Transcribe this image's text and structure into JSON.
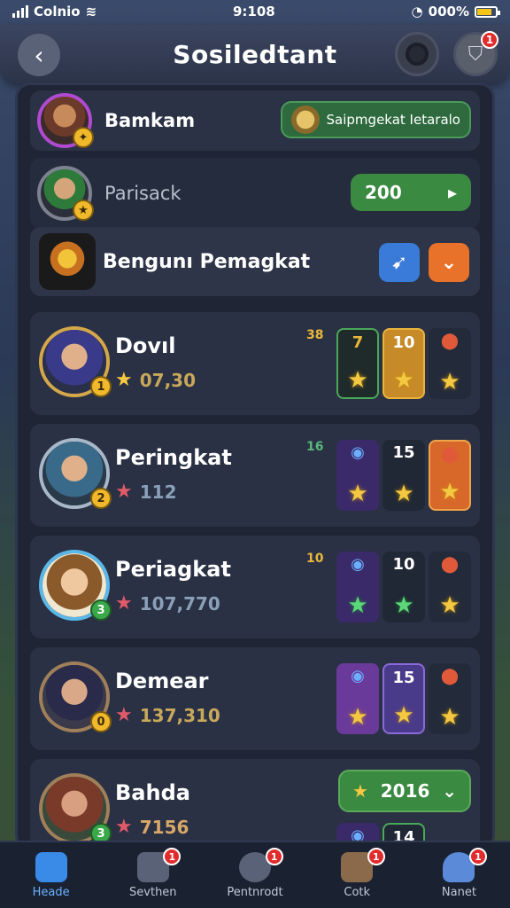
{
  "status_bar": {
    "carrier": "Colnio",
    "time": "9:108",
    "battery": "000%",
    "battery_level": 0.8
  },
  "header": {
    "title": "Sosiledtant",
    "notification_count": "1"
  },
  "rows": {
    "first": {
      "name": "Bamkam",
      "tag": "Saipmgekat Ietaralo"
    },
    "second": {
      "name": "Parisack",
      "score": "200"
    },
    "third": {
      "name": "Bengunı Pemagkat"
    }
  },
  "players": [
    {
      "name": "Dovıl",
      "score": "07,30",
      "level": "1",
      "rank": "38",
      "c2": "10",
      "c1_num": "7"
    },
    {
      "name": "Peringkat",
      "score": "112",
      "level": "2",
      "rank": "16",
      "c2": "15"
    },
    {
      "name": "Periagkat",
      "score": "107,770",
      "level": "3",
      "rank": "10",
      "c2": "10"
    },
    {
      "name": "Demear",
      "score": "137,310",
      "level": "0",
      "rank": "",
      "c2": "15"
    },
    {
      "name": "Bahda",
      "score": "7156",
      "level": "3",
      "year": "2016",
      "c2": "14"
    }
  ],
  "nav": [
    {
      "label": "Heade",
      "badge": ""
    },
    {
      "label": "Sevthen",
      "badge": "1"
    },
    {
      "label": "Pentnrodt",
      "badge": "1"
    },
    {
      "label": "Cotk",
      "badge": "1"
    },
    {
      "label": "Nanet",
      "badge": "1"
    }
  ],
  "colors": {
    "accent_green": "#3b8a42",
    "accent_blue": "#3a8ae8",
    "badge_red": "#e02c2c"
  }
}
